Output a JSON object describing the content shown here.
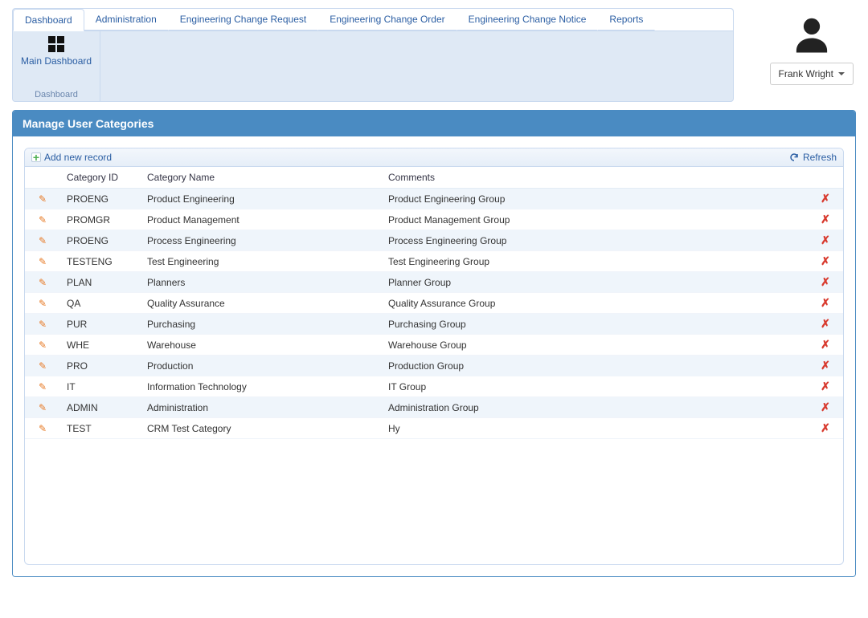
{
  "tabs": [
    "Dashboard",
    "Administration",
    "Engineering Change Request",
    "Engineering Change Order",
    "Engineering Change Notice",
    "Reports"
  ],
  "activeTab": 0,
  "ribbon": {
    "mainDashboard": "Main Dashboard",
    "groupLabel": "Dashboard"
  },
  "user": {
    "name": "Frank Wright"
  },
  "panel": {
    "title": "Manage User Categories"
  },
  "grid": {
    "addLabel": "Add new record",
    "refreshLabel": "Refresh",
    "columns": {
      "id": "Category ID",
      "name": "Category Name",
      "comments": "Comments"
    },
    "rows": [
      {
        "id": "PROENG",
        "name": "Product Engineering",
        "comments": "Product Engineering Group"
      },
      {
        "id": "PROMGR",
        "name": "Product Management",
        "comments": "Product Management Group"
      },
      {
        "id": "PROENG",
        "name": "Process Engineering",
        "comments": "Process Engineering Group"
      },
      {
        "id": "TESTENG",
        "name": "Test Engineering",
        "comments": "Test Engineering Group"
      },
      {
        "id": "PLAN",
        "name": "Planners",
        "comments": "Planner Group"
      },
      {
        "id": "QA",
        "name": "Quality Assurance",
        "comments": "Quality Assurance Group"
      },
      {
        "id": "PUR",
        "name": "Purchasing",
        "comments": "Purchasing Group"
      },
      {
        "id": "WHE",
        "name": "Warehouse",
        "comments": "Warehouse Group"
      },
      {
        "id": "PRO",
        "name": "Production",
        "comments": "Production Group"
      },
      {
        "id": "IT",
        "name": "Information Technology",
        "comments": "IT Group"
      },
      {
        "id": "ADMIN",
        "name": "Administration",
        "comments": "Administration Group"
      },
      {
        "id": "TEST",
        "name": "CRM Test Category",
        "comments": "Hy"
      }
    ]
  }
}
